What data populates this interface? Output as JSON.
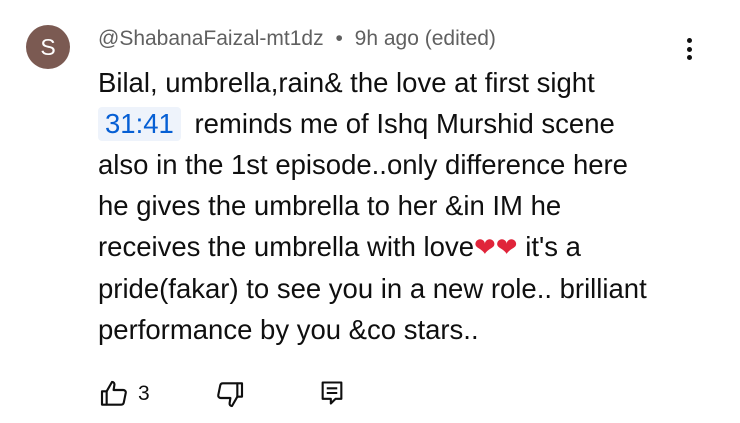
{
  "comment": {
    "avatar_letter": "S",
    "author": "@ShabanaFaizal-mt1dz",
    "separator": "•",
    "time": "9h ago (edited)",
    "line1": "Bilal, umbrella,rain& the love at first sight",
    "timestamp_link": "31:41",
    "line2_rest": "reminds me of Ishq Murshid scene",
    "line3": "also in the 1st episode..only difference here",
    "line4": "he gives the umbrella to her &in IM he",
    "line5_start": "receives the umbrella with love",
    "hearts": "❤❤",
    "line5_end": "it's a",
    "line6": "pride(fakar) to see you in a new role.. brilliant",
    "line7": "performance by you &co stars..",
    "like_count": "3"
  },
  "colors": {
    "avatar_bg": "#7b5a52",
    "timestamp_link": "#065fd4",
    "meta_text": "#606060"
  },
  "icons": {
    "menu": "vertical-dots-icon",
    "like": "thumb-up-icon",
    "dislike": "thumb-down-icon",
    "reply": "reply-icon"
  }
}
